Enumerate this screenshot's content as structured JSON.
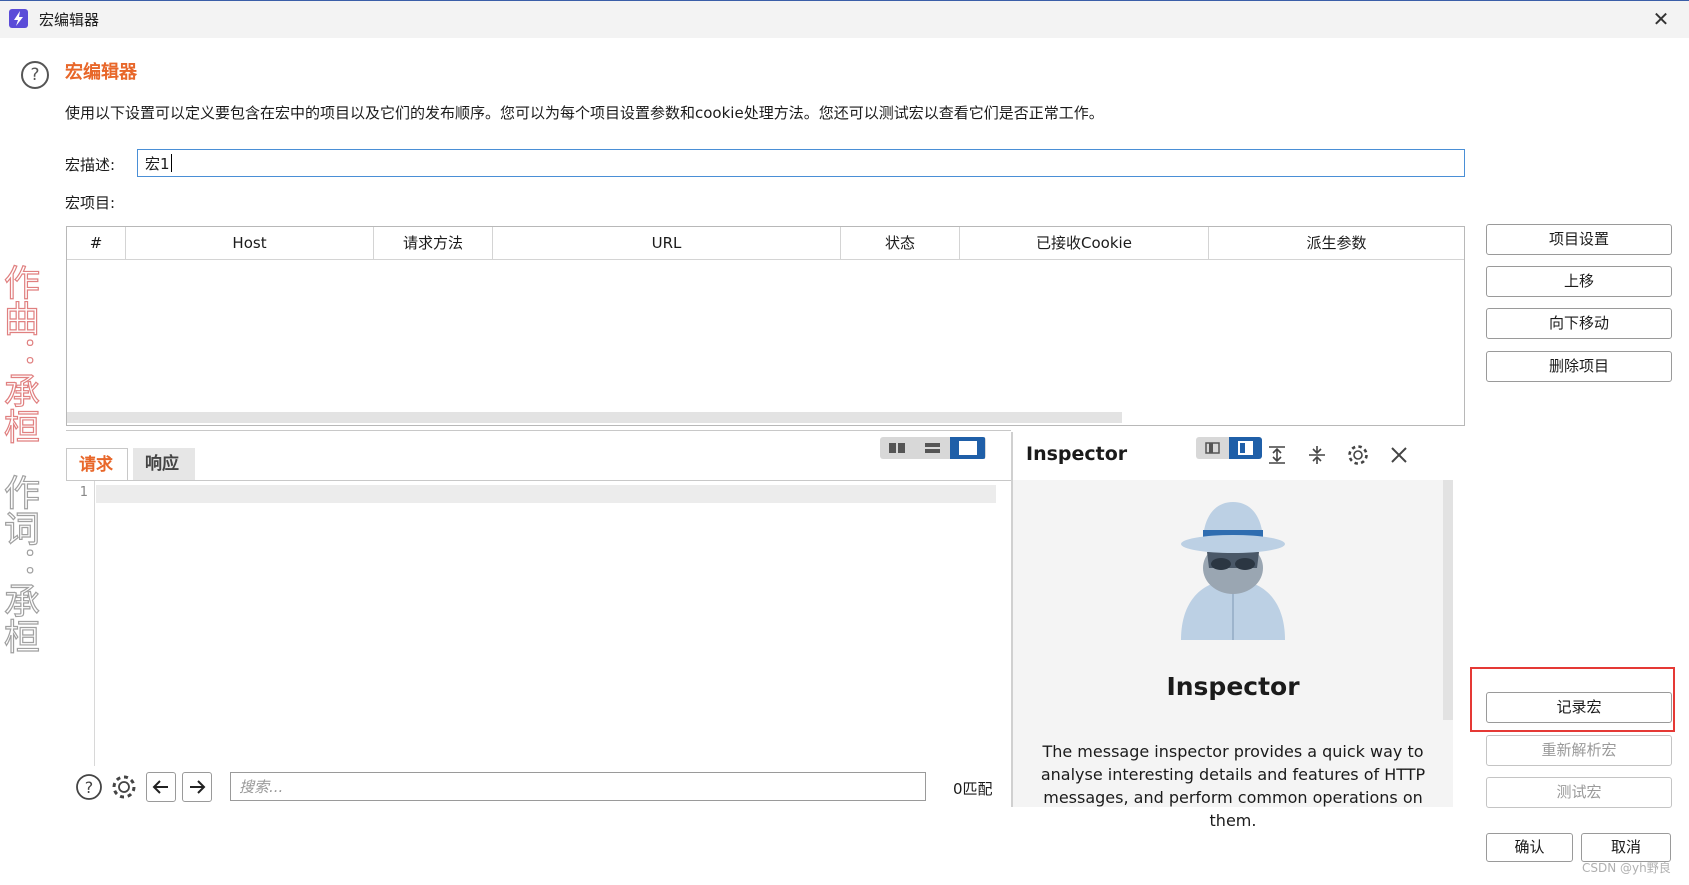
{
  "window": {
    "title": "宏编辑器",
    "close_glyph": "✕"
  },
  "header": {
    "title": "宏编辑器",
    "description": "使用以下设置可以定义要包含在宏中的项目以及它们的发布顺序。您可以为每个项目设置参数和cookie处理方法。您还可以测试宏以查看它们是否正常工作。"
  },
  "form": {
    "desc_label": "宏描述:",
    "desc_value": "宏1",
    "items_label": "宏项目:"
  },
  "table": {
    "columns": [
      "#",
      "Host",
      "请求方法",
      "URL",
      "状态",
      "已接收Cookie",
      "派生参数"
    ],
    "rows": []
  },
  "side_buttons": {
    "item_settings": "项目设置",
    "move_up": "上移",
    "move_down": "向下移动",
    "delete_item": "删除项目",
    "record_macro": "记录宏",
    "reanalyze_macro": "重新解析宏",
    "test_macro": "测试宏"
  },
  "editor": {
    "tabs": [
      "请求",
      "响应"
    ],
    "active_tab": "请求",
    "line_number": "1",
    "search_placeholder": "搜索...",
    "match_count": "0匹配"
  },
  "inspector": {
    "title": "Inspector",
    "heading": "Inspector",
    "body": "The message inspector provides a quick way to analyse interesting details and features of HTTP messages, and perform common operations on them."
  },
  "footer": {
    "ok": "确认",
    "cancel": "取消"
  },
  "watermark": {
    "line1": "作曲：承桓",
    "line2": "作词：承桓"
  },
  "credit": "CSDN @yh野良",
  "colors": {
    "accent": "#e8672a",
    "primary": "#1f5fa8",
    "highlight": "#e53935"
  }
}
